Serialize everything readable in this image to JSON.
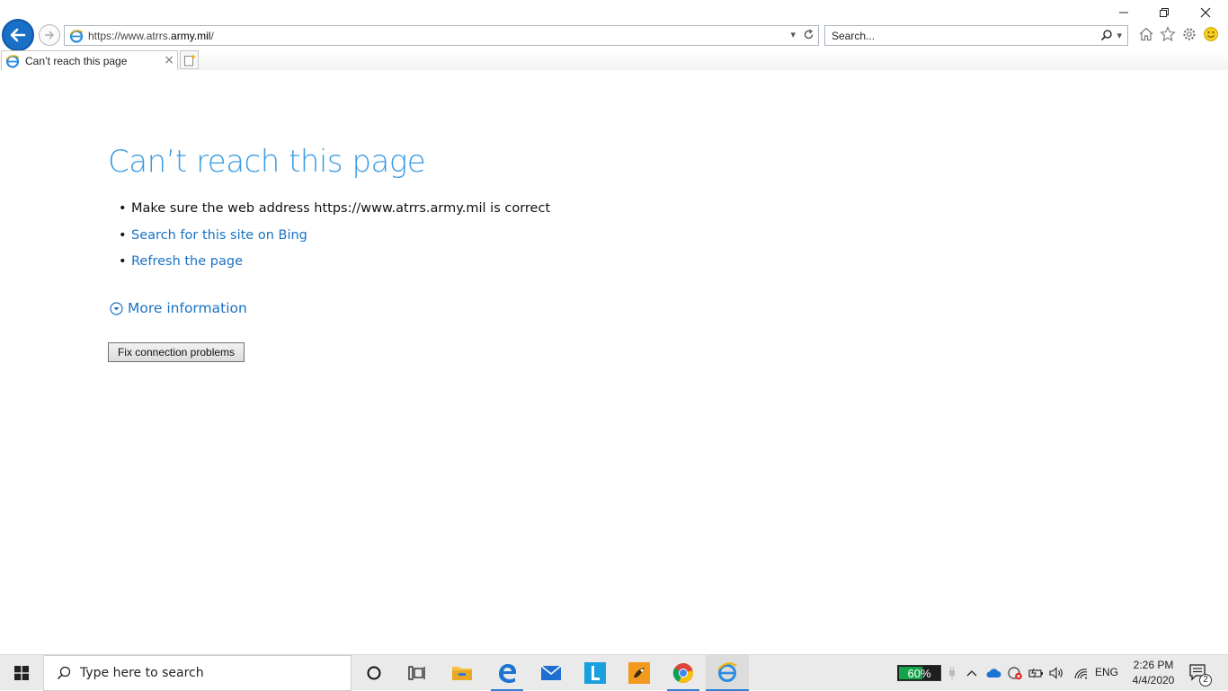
{
  "browser": {
    "address": {
      "url_prefix": "https://www.atrrs.",
      "url_domain": "army.mil",
      "url_suffix": "/"
    },
    "search": {
      "placeholder": "Search..."
    },
    "tab": {
      "title": "Can’t reach this page"
    }
  },
  "page": {
    "heading": "Can’t reach this page",
    "bullets": [
      "Make sure the web address https://www.atrrs.army.mil is correct",
      "Search for this site on Bing",
      "Refresh the page"
    ],
    "more_info": "More information",
    "fix_button": "Fix connection problems"
  },
  "taskbar": {
    "search_placeholder": "Type here to search",
    "battery_percent": "60%",
    "battery_level": 0.6,
    "language": "ENG",
    "time": "2:26 PM",
    "date": "4/4/2020",
    "notification_count": "2"
  },
  "colors": {
    "heading": "#3a9be2",
    "link": "#1a72c4",
    "back_button": "#1a6fc7",
    "battery": "#13a34a"
  },
  "icons": {
    "back": "arrow-left-icon",
    "forward": "arrow-right-icon",
    "refresh": "refresh-icon",
    "home": "home-icon",
    "favorites": "star-icon",
    "settings": "gear-icon",
    "feedback": "smiley-icon"
  }
}
